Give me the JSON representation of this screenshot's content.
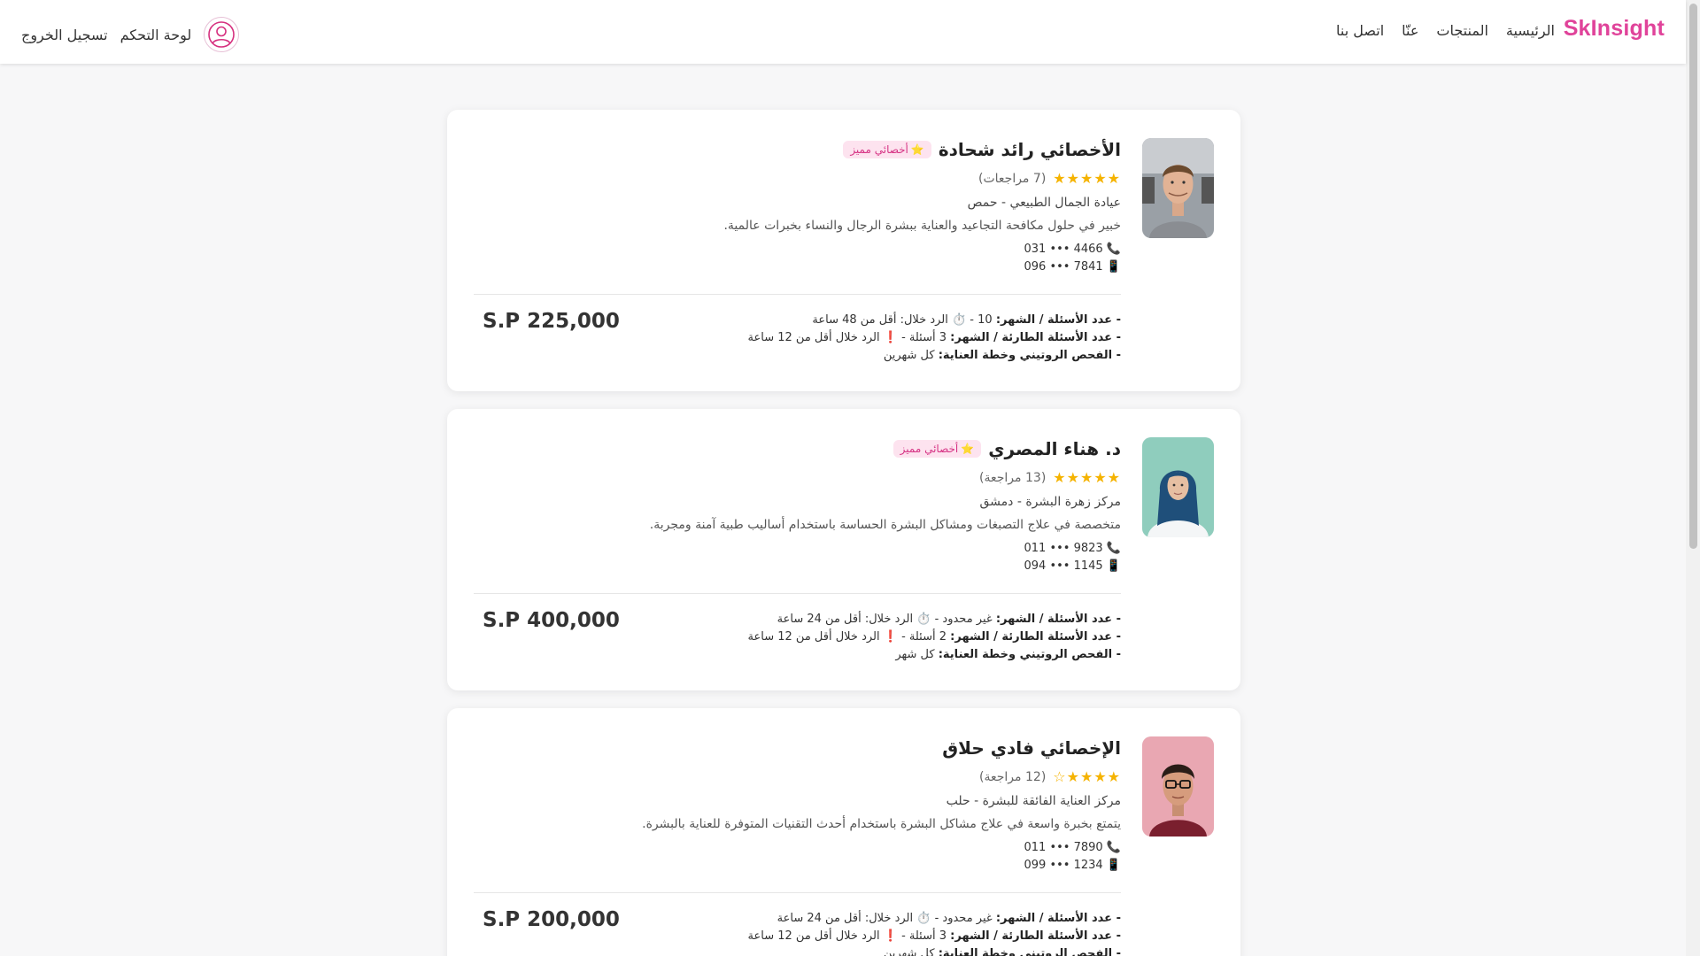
{
  "header": {
    "brand": "SkInsight",
    "nav": [
      "الرئيسية",
      "المنتجات",
      "عنّا",
      "اتصل بنا"
    ],
    "dashboard": "لوحة التحكم",
    "logout": "تسجيل الخروج"
  },
  "specialists": [
    {
      "name": "الأخصائي رائد شحادة",
      "badge": "أخصائي مميز",
      "featured": true,
      "stars": "★★★★★",
      "rating": 5,
      "reviews": "(7 مراجعات)",
      "clinic": "عيادة الجمال الطبيعي - حمص",
      "description": "خبير في حلول مكافحة التجاعيد والعناية ببشرة الرجال والنساء بخبرات عالمية.",
      "phone": "031 ••• 4466",
      "mobile": "096 ••• 7841",
      "q_label": "- عدد الأسئلة / الشهر:",
      "q_value": "10 - ⏱️ الرد خلال: أقل من 48 ساعة",
      "eq_label": "- عدد الأسئلة الطارئة / الشهر:",
      "eq_value": "3 أسئلة - ❗ الرد خلال أقل من 12 ساعة",
      "check_label": "- الفحص الروتيني وخطة العناية:",
      "check_value": "كل شهرين",
      "price": "S.P 225,000"
    },
    {
      "name": "د. هناء المصري",
      "badge": "أخصائي مميز",
      "featured": true,
      "stars": "★★★★★",
      "rating": 5,
      "reviews": "(13 مراجعة)",
      "clinic": "مركز زهرة البشرة - دمشق",
      "description": "متخصصة في علاج التصبغات ومشاكل البشرة الحساسة باستخدام أساليب طبية آمنة ومجربة.",
      "phone": "011 ••• 9823",
      "mobile": "094 ••• 1145",
      "q_label": "- عدد الأسئلة / الشهر:",
      "q_value": "غير محدود - ⏱️ الرد خلال: أقل من 24 ساعة",
      "eq_label": "- عدد الأسئلة الطارئة / الشهر:",
      "eq_value": "2 أسئلة - ❗ الرد خلال أقل من 12 ساعة",
      "check_label": "- الفحص الروتيني وخطة العناية:",
      "check_value": "كل شهر",
      "price": "S.P 400,000"
    },
    {
      "name": "الإخصائي فادي حلاق",
      "badge": "",
      "featured": false,
      "stars": "★★★★☆",
      "rating": 4,
      "reviews": "(12 مراجعة)",
      "clinic": "مركز العناية الفائقة للبشرة - حلب",
      "description": "يتمتع بخبرة واسعة في علاج مشاكل البشرة باستخدام أحدث التقنيات المتوفرة للعناية بالبشرة.",
      "phone": "011 ••• 7890",
      "mobile": "099 ••• 1234",
      "q_label": "- عدد الأسئلة / الشهر:",
      "q_value": "غير محدود - ⏱️ الرد خلال: أقل من 24 ساعة",
      "eq_label": "- عدد الأسئلة الطارئة / الشهر:",
      "eq_value": "3 أسئلة - ❗ الرد خلال أقل من 12 ساعة",
      "check_label": "- الفحص الروتيني وخطة العناية:",
      "check_value": "كل شهرين",
      "price": "S.P 200,000"
    }
  ],
  "colors": {
    "brand": "#e0439a",
    "star": "#f5b301",
    "badge_bg": "#fde3ef",
    "badge_text": "#d63384"
  },
  "icons": [
    "user-circle-icon",
    "phone-icon",
    "mobile-icon",
    "star-icon",
    "timer-icon",
    "alert-icon"
  ]
}
